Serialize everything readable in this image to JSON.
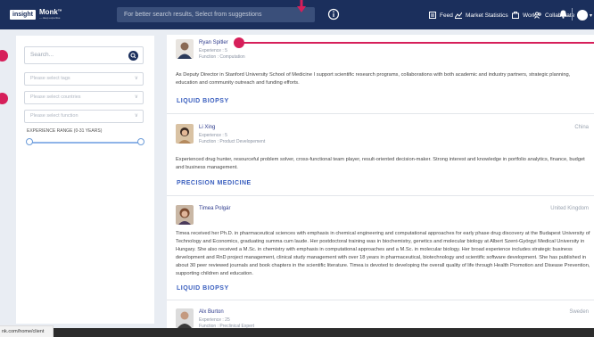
{
  "colors": {
    "nav_bg": "#1b2f5c",
    "annotation_red": "#d61f5a",
    "tag_blue": "#3a5fbf"
  },
  "brand": {
    "logo_box": "insight",
    "logo_word": "Monk",
    "logo_sup": "TM",
    "tagline": "— deep expertise"
  },
  "nav": {
    "search_placeholder": "For better search results, Select from suggestions",
    "items": [
      {
        "label": "Feed",
        "icon": "feed-icon"
      },
      {
        "label": "Market Statistics",
        "icon": "chart-icon"
      },
      {
        "label": "Work",
        "icon": "briefcase-icon"
      },
      {
        "label": "Collaborate",
        "icon": "people-icon"
      }
    ]
  },
  "sidebar": {
    "search_placeholder": "Search...",
    "tags_placeholder": "Please select tags",
    "countries_placeholder": "Please select countries",
    "function_placeholder": "Please select function",
    "range_label": "EXPERIENCE RANGE (0-31 YEARS)",
    "range_min": 0,
    "range_max": 31
  },
  "experts": [
    {
      "name": "Ryan Spitler",
      "experience": "Experience : 5",
      "function": "Function : Computation",
      "country": "",
      "description": "As Deputy Director in Stanford University School of Medicine I support scientific research programs, collaborations with both academic and industry partners, strategic planning, education and community outreach and funding efforts.",
      "tag": "LIQUID BIOPSY"
    },
    {
      "name": "Li Xing",
      "experience": "Experience : 5",
      "function": "Function : Product Developement",
      "country": "China",
      "description": "Experienced drug hunter, resourceful problem solver, cross-functional team player, result-oriented decision-maker. Strong interest and knowledge in portfolio analytics, finance, budget and business management.",
      "tag": "PRECISION MEDICINE"
    },
    {
      "name": "Timea Polgár",
      "experience": "",
      "function": "",
      "country": "United Kingdom",
      "description": "Timea received her Ph.D. in pharmaceutical sciences with emphasis in chemical engineering and computational approaches for early phase drug discovery at the Budapest University of Technology and Economics, graduating summa cum laude. Her postdoctoral training was in biochemistry, genetics and molecular biology at Albert Szent-Györgyi Medical University in Hungary. She also received a M.Sc. in chemistry with emphasis in computational approaches and a M.Sc. in molecular biology. Her broad experience includes strategic business development and RnD project management, clinical study management with over 18 years in pharmaceutical, biotechnology and scientific software development. She has published in about 30 peer reviewed journals and book chapters in the scientific literature. Timea is devoted to developing the overall quality of life through Health Promotion and Disease Prevention, supporting children and education.",
      "tag": "LIQUID BIOPSY"
    },
    {
      "name": "Alx Burton",
      "experience": "Experience : 25",
      "function": "Function : Preclinical Expert",
      "country": "Sweden",
      "description": "",
      "tag": ""
    }
  ],
  "status_url": "nk.com/home/client"
}
